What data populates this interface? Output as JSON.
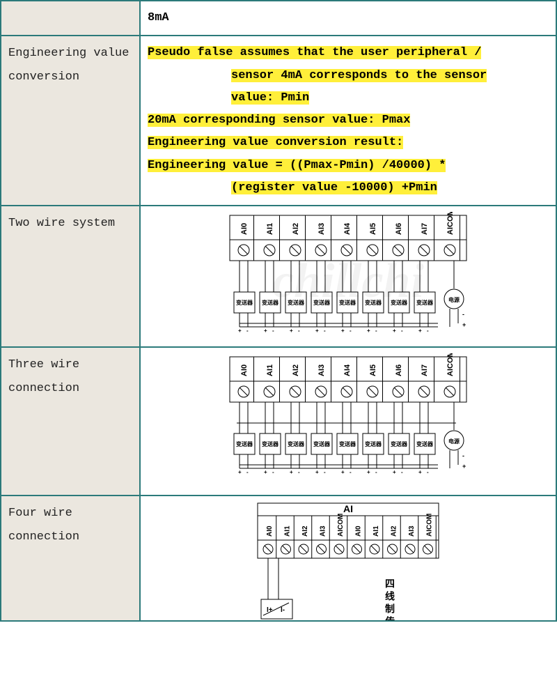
{
  "rows": {
    "r0": {
      "label": "",
      "content": "8mA"
    },
    "r1": {
      "label": "Engineering value conversion",
      "line1": "Pseudo false assumes that the user peripheral /",
      "line2": "sensor 4mA corresponds to the sensor",
      "line3": "value: Pmin",
      "line4": "20mA corresponding sensor value: Pmax",
      "line5": "Engineering value conversion result:",
      "line6": "Engineering value = ((Pmax-Pmin) /40000) *",
      "line7": "(register value -10000) +Pmin"
    },
    "r2": {
      "label": "Two wire system"
    },
    "r3": {
      "label": "Three wire connection"
    },
    "r4": {
      "label": "Four wire connection"
    }
  },
  "diagram": {
    "channels8": [
      "AI0",
      "AI1",
      "AI2",
      "AI3",
      "AI4",
      "AI5",
      "AI6",
      "AI7",
      "AICOM"
    ],
    "channels4": [
      "AI0",
      "AI1",
      "AI2",
      "AI3",
      "AICOM",
      "AI0",
      "AI1",
      "AI2",
      "AI3",
      "AICOM"
    ],
    "ai_header": "AI",
    "transmitter": "变送器",
    "power": "电源",
    "four_wire_label": "四线制传",
    "watermark": "chillchi"
  }
}
